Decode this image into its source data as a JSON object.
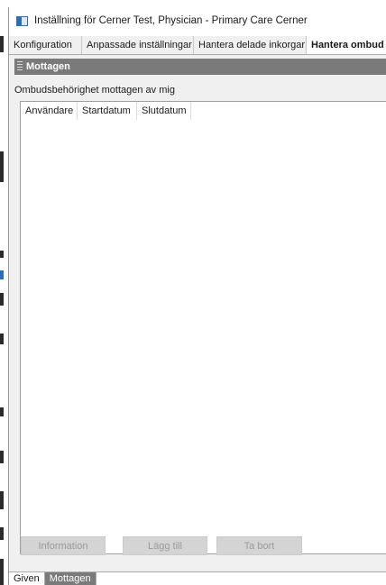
{
  "window": {
    "title": "Inställning för Cerner Test, Physician - Primary Care Cerner",
    "icon": "window-app-icon"
  },
  "tabs": [
    {
      "label": "Konfiguration",
      "active": false
    },
    {
      "label": "Anpassade inställningar",
      "active": false
    },
    {
      "label": "Hantera delade inkorgar",
      "active": false
    },
    {
      "label": "Hantera ombud",
      "active": true
    }
  ],
  "panel": {
    "header": "Mottagen",
    "section_label": "Ombudsbehörighet mottagen av mig",
    "columns": [
      "Användare",
      "Startdatum",
      "Slutdatum"
    ],
    "rows": []
  },
  "buttons": {
    "information": "Information",
    "add": "Lägg till",
    "remove": "Ta bort"
  },
  "bottom_tabs": [
    {
      "label": "Given",
      "active": false
    },
    {
      "label": "Mottagen",
      "active": true
    }
  ],
  "colors": {
    "panel_header_bg": "#7a7a7a",
    "active_bottom_tab_bg": "#7a7a7a",
    "disabled_button_bg": "#d4d4d4"
  }
}
